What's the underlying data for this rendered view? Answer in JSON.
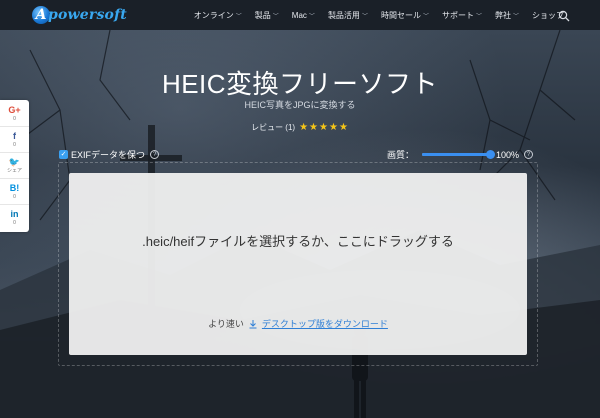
{
  "logo": {
    "mark": "A",
    "text": "powersoft"
  },
  "nav": {
    "items": [
      {
        "label": "オンライン",
        "has_dropdown": true
      },
      {
        "label": "製品",
        "has_dropdown": true
      },
      {
        "label": "Mac",
        "has_dropdown": true
      },
      {
        "label": "製品活用",
        "has_dropdown": true
      },
      {
        "label": "時間セール",
        "has_dropdown": true
      },
      {
        "label": "サポート",
        "has_dropdown": true
      },
      {
        "label": "弊社",
        "has_dropdown": true
      },
      {
        "label": "ショップ",
        "has_dropdown": false
      }
    ],
    "search_icon": "search-icon"
  },
  "hero": {
    "title": "HEIC変換フリーソフト",
    "subtitle": "HEIC写真をJPGに変換する",
    "review_label": "レビュー (1)",
    "stars": "★★★★★",
    "rating": 5
  },
  "options": {
    "exif_label": "EXIFデータを保つ",
    "exif_checked": true,
    "help_glyph": "?",
    "quality_label": "画質：",
    "quality_value": "100%",
    "quality_fraction": 1.0
  },
  "dropzone": {
    "prompt": ".heic/heifファイルを選択するか、ここにドラッグする",
    "faster_label": "より速い",
    "download_link": "デスクトップ版をダウンロード"
  },
  "social": [
    {
      "glyph": "G+",
      "count": "0",
      "color": "#dd4b39",
      "icon": "google-plus-icon"
    },
    {
      "glyph": "f",
      "count": "0",
      "color": "#3b5998",
      "icon": "facebook-icon"
    },
    {
      "glyph": "🐦",
      "count": "シェア",
      "color": "#1da1f2",
      "icon": "twitter-icon"
    },
    {
      "glyph": "B!",
      "count": "0",
      "color": "#008fde",
      "icon": "hatena-bookmark-icon"
    },
    {
      "glyph": "in",
      "count": "0",
      "color": "#0077b5",
      "icon": "linkedin-icon"
    }
  ],
  "colors": {
    "accent": "#3a8ff0",
    "link": "#2f7fd6",
    "star": "#f5c518",
    "nav_bg": "#1a2028"
  }
}
